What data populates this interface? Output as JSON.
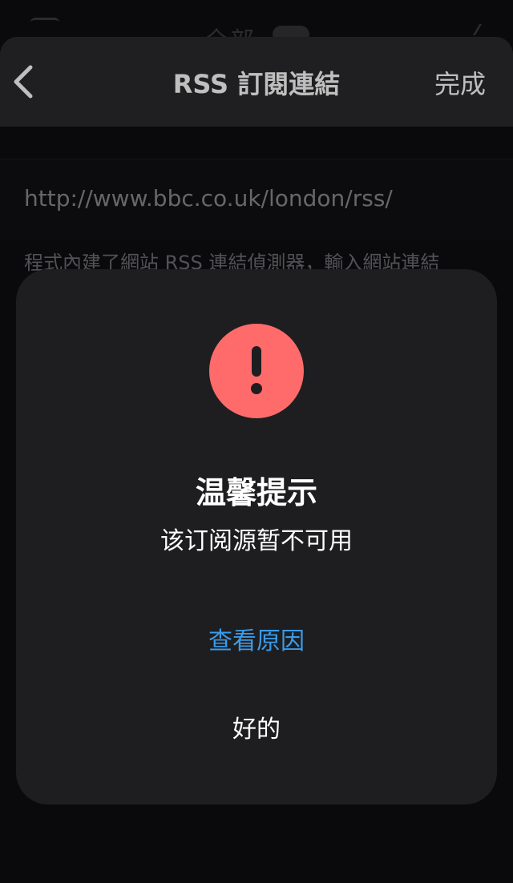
{
  "background_app": {
    "title": "全部"
  },
  "nav": {
    "back_icon": "chevron-left-icon",
    "title": "RSS 訂閱連結",
    "done_label": "完成"
  },
  "feed": {
    "url": "http://www.bbc.co.uk/london/rss/",
    "hint": "程式內建了網站 RSS 連結偵測器，輸入網站連結"
  },
  "dialog": {
    "icon": "exclamation-circle-icon",
    "title": "温馨提示",
    "message": "该订阅源暂不可用",
    "reason_label": "查看原因",
    "ok_label": "好的"
  },
  "colors": {
    "alert_icon": "#ff6b6b",
    "link": "#3b9be8",
    "dialog_bg": "#1e1e20",
    "nav_bg": "#2a2a2c"
  }
}
